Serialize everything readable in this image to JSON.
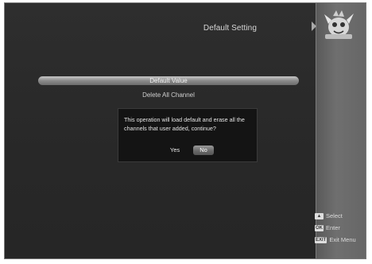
{
  "header": {
    "title": "Default Setting"
  },
  "logo": {
    "icon": "mascot-logo-icon"
  },
  "menu": {
    "items": [
      {
        "label": "Default Value",
        "selected": true
      },
      {
        "label": "Delete All Channel",
        "selected": false
      }
    ]
  },
  "dialog": {
    "message": "This operation will load default and erase all the channels that user added, continue?",
    "yes_label": "Yes",
    "no_label": "No",
    "focused": "No"
  },
  "legend": {
    "items": [
      {
        "key": "▲",
        "key_icon": "arrow-keys-icon",
        "label": "Select"
      },
      {
        "key": "OK",
        "key_icon": "ok-key-icon",
        "label": "Enter"
      },
      {
        "key": "EXIT",
        "key_icon": "exit-key-icon",
        "label": "Exit Menu"
      }
    ]
  },
  "colors": {
    "background": "#2b2b2b",
    "side_panel": "#6a6a6a",
    "highlight": "#9a9a9a",
    "dialog_bg": "#141414",
    "text": "#e0e0e0"
  }
}
